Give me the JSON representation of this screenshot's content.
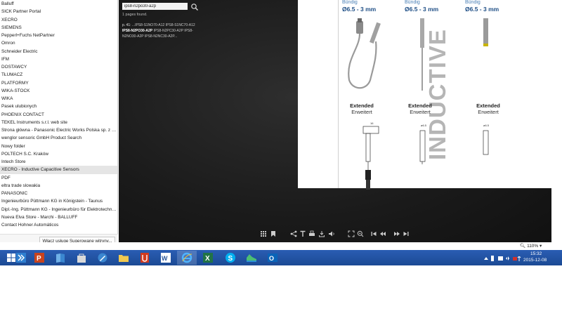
{
  "favorites": {
    "items": [
      "Balluff",
      "SICK Partner Portal",
      "XECRO",
      "SIEMENS",
      "Pepperl+Fuchs  NetPartner",
      "Omron",
      "Schneider Electric",
      "IFM",
      "DOSTAWCY",
      "TŁUMACZ",
      "PLATFORMY",
      "WIKA-STOCK",
      "WIKA",
      "Pasek ulubionych",
      "PHOENIX CONTACT",
      "TEKEL Instruments s.r.l. web site",
      "Strona główna - Panasonic Electric Works Polska sp. z o.o.",
      "wenglor sensoric GmbH    Product Search",
      "Nowy folder",
      "POLTECH S.C. Kraków",
      "Intech Store",
      "XECRO - Inductive  Capacitive Sensors",
      "PDF",
      "eltra trade slowakia",
      "PANASONIC",
      "Ingenieurbüro Püttmann KG in Königstein - Taunus",
      "Dipl.-Ing. Püttmann KG - Ingenieurbüro für Elektrotechnik ...",
      "Nueva Elva Store - Marchi - BALLUFF",
      "Contact  Hohner Automáticos"
    ],
    "suggest_button": "Włącz usługę Sugerowane witryny..."
  },
  "viewer": {
    "search_value": "ips8-n2po30-a2p",
    "pages_found": "1 pages found.",
    "result_page": "p. 41:",
    "result_pre": " ...IPS8-S1NO70-A12 IPS8-S1NC70-A12 ",
    "result_match": "IPS8-N2PO30-A2P",
    "result_post": " IPS8-N2PC30-A2P IPS8-N2NO30-A2P IPS8-N2NC30-A2P..."
  },
  "catalog": {
    "title": "INDUCTIVE",
    "columns": [
      {
        "buendig": "Bündig",
        "diameter": "Ø6.5 - 3 mm",
        "ext_en": "Extended",
        "ext_de": "Erweitert"
      },
      {
        "buendig": "Bündig",
        "diameter": "Ø6.5 - 3 mm",
        "ext_en": "Extended",
        "ext_de": "Erweitert"
      },
      {
        "buendig": "Bündig",
        "diameter": "Ø6.5 - 3 mm",
        "ext_en": "Extended",
        "ext_de": "Erweitert"
      }
    ]
  },
  "status": {
    "zoom": "110%"
  },
  "taskbar": {
    "time": "15:32",
    "date": "2015-12-08"
  },
  "colors": {
    "taskbar": "#1f4f9c",
    "accent_blue": "#1f4f86",
    "viewer_bg": "#1e1e1e"
  }
}
